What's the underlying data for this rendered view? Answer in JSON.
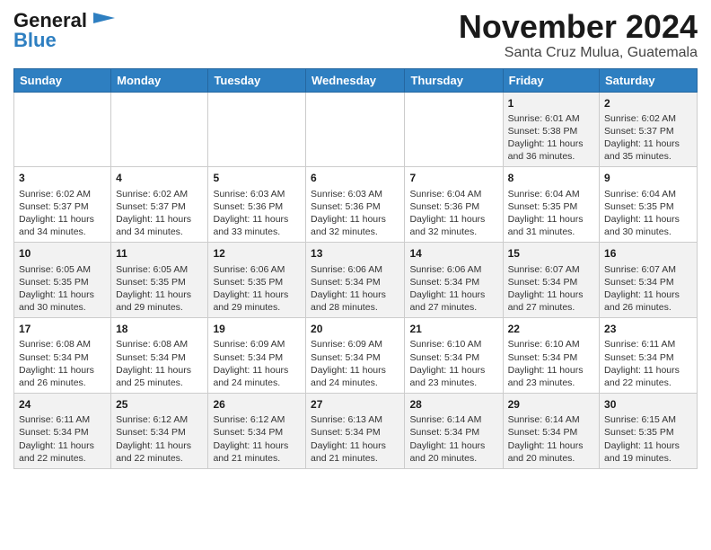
{
  "header": {
    "logo_line1": "General",
    "logo_line2": "Blue",
    "month": "November 2024",
    "location": "Santa Cruz Mulua, Guatemala"
  },
  "weekdays": [
    "Sunday",
    "Monday",
    "Tuesday",
    "Wednesday",
    "Thursday",
    "Friday",
    "Saturday"
  ],
  "weeks": [
    [
      {
        "day": "",
        "text": ""
      },
      {
        "day": "",
        "text": ""
      },
      {
        "day": "",
        "text": ""
      },
      {
        "day": "",
        "text": ""
      },
      {
        "day": "",
        "text": ""
      },
      {
        "day": "1",
        "text": "Sunrise: 6:01 AM\nSunset: 5:38 PM\nDaylight: 11 hours and 36 minutes."
      },
      {
        "day": "2",
        "text": "Sunrise: 6:02 AM\nSunset: 5:37 PM\nDaylight: 11 hours and 35 minutes."
      }
    ],
    [
      {
        "day": "3",
        "text": "Sunrise: 6:02 AM\nSunset: 5:37 PM\nDaylight: 11 hours and 34 minutes."
      },
      {
        "day": "4",
        "text": "Sunrise: 6:02 AM\nSunset: 5:37 PM\nDaylight: 11 hours and 34 minutes."
      },
      {
        "day": "5",
        "text": "Sunrise: 6:03 AM\nSunset: 5:36 PM\nDaylight: 11 hours and 33 minutes."
      },
      {
        "day": "6",
        "text": "Sunrise: 6:03 AM\nSunset: 5:36 PM\nDaylight: 11 hours and 32 minutes."
      },
      {
        "day": "7",
        "text": "Sunrise: 6:04 AM\nSunset: 5:36 PM\nDaylight: 11 hours and 32 minutes."
      },
      {
        "day": "8",
        "text": "Sunrise: 6:04 AM\nSunset: 5:35 PM\nDaylight: 11 hours and 31 minutes."
      },
      {
        "day": "9",
        "text": "Sunrise: 6:04 AM\nSunset: 5:35 PM\nDaylight: 11 hours and 30 minutes."
      }
    ],
    [
      {
        "day": "10",
        "text": "Sunrise: 6:05 AM\nSunset: 5:35 PM\nDaylight: 11 hours and 30 minutes."
      },
      {
        "day": "11",
        "text": "Sunrise: 6:05 AM\nSunset: 5:35 PM\nDaylight: 11 hours and 29 minutes."
      },
      {
        "day": "12",
        "text": "Sunrise: 6:06 AM\nSunset: 5:35 PM\nDaylight: 11 hours and 29 minutes."
      },
      {
        "day": "13",
        "text": "Sunrise: 6:06 AM\nSunset: 5:34 PM\nDaylight: 11 hours and 28 minutes."
      },
      {
        "day": "14",
        "text": "Sunrise: 6:06 AM\nSunset: 5:34 PM\nDaylight: 11 hours and 27 minutes."
      },
      {
        "day": "15",
        "text": "Sunrise: 6:07 AM\nSunset: 5:34 PM\nDaylight: 11 hours and 27 minutes."
      },
      {
        "day": "16",
        "text": "Sunrise: 6:07 AM\nSunset: 5:34 PM\nDaylight: 11 hours and 26 minutes."
      }
    ],
    [
      {
        "day": "17",
        "text": "Sunrise: 6:08 AM\nSunset: 5:34 PM\nDaylight: 11 hours and 26 minutes."
      },
      {
        "day": "18",
        "text": "Sunrise: 6:08 AM\nSunset: 5:34 PM\nDaylight: 11 hours and 25 minutes."
      },
      {
        "day": "19",
        "text": "Sunrise: 6:09 AM\nSunset: 5:34 PM\nDaylight: 11 hours and 24 minutes."
      },
      {
        "day": "20",
        "text": "Sunrise: 6:09 AM\nSunset: 5:34 PM\nDaylight: 11 hours and 24 minutes."
      },
      {
        "day": "21",
        "text": "Sunrise: 6:10 AM\nSunset: 5:34 PM\nDaylight: 11 hours and 23 minutes."
      },
      {
        "day": "22",
        "text": "Sunrise: 6:10 AM\nSunset: 5:34 PM\nDaylight: 11 hours and 23 minutes."
      },
      {
        "day": "23",
        "text": "Sunrise: 6:11 AM\nSunset: 5:34 PM\nDaylight: 11 hours and 22 minutes."
      }
    ],
    [
      {
        "day": "24",
        "text": "Sunrise: 6:11 AM\nSunset: 5:34 PM\nDaylight: 11 hours and 22 minutes."
      },
      {
        "day": "25",
        "text": "Sunrise: 6:12 AM\nSunset: 5:34 PM\nDaylight: 11 hours and 22 minutes."
      },
      {
        "day": "26",
        "text": "Sunrise: 6:12 AM\nSunset: 5:34 PM\nDaylight: 11 hours and 21 minutes."
      },
      {
        "day": "27",
        "text": "Sunrise: 6:13 AM\nSunset: 5:34 PM\nDaylight: 11 hours and 21 minutes."
      },
      {
        "day": "28",
        "text": "Sunrise: 6:14 AM\nSunset: 5:34 PM\nDaylight: 11 hours and 20 minutes."
      },
      {
        "day": "29",
        "text": "Sunrise: 6:14 AM\nSunset: 5:34 PM\nDaylight: 11 hours and 20 minutes."
      },
      {
        "day": "30",
        "text": "Sunrise: 6:15 AM\nSunset: 5:35 PM\nDaylight: 11 hours and 19 minutes."
      }
    ]
  ]
}
